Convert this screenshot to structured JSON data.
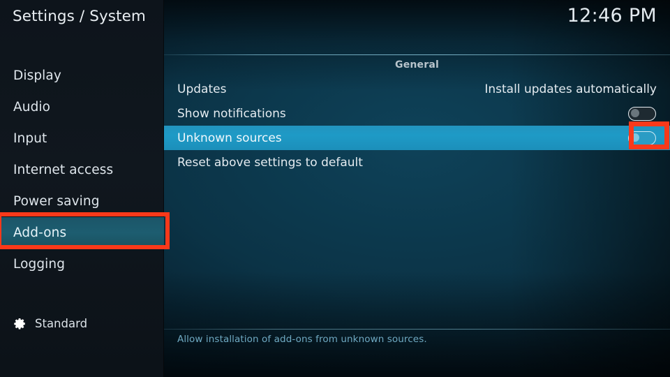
{
  "header": {
    "title": "Settings / System",
    "clock": "12:46 PM"
  },
  "sidebar": {
    "items": [
      {
        "label": "Display",
        "selected": false
      },
      {
        "label": "Audio",
        "selected": false
      },
      {
        "label": "Input",
        "selected": false
      },
      {
        "label": "Internet access",
        "selected": false
      },
      {
        "label": "Power saving",
        "selected": false
      },
      {
        "label": "Add-ons",
        "selected": true
      },
      {
        "label": "Logging",
        "selected": false
      }
    ],
    "profile": {
      "icon": "gear-icon",
      "label": "Standard"
    }
  },
  "main": {
    "group_header": "General",
    "rows": [
      {
        "label": "Updates",
        "type": "value",
        "value": "Install updates automatically",
        "selected": false
      },
      {
        "label": "Show notifications",
        "type": "toggle",
        "toggle_state": "off",
        "selected": false
      },
      {
        "label": "Unknown sources",
        "type": "toggle",
        "toggle_state": "off",
        "selected": true
      },
      {
        "label": "Reset above settings to default",
        "type": "action",
        "value": "",
        "selected": false
      }
    ],
    "help_text": "Allow installation of add-ons from unknown sources."
  },
  "annotations": {
    "color": "#f9391a",
    "boxes": [
      {
        "name": "addons-highlight",
        "target": "sidebar-item-add-ons"
      },
      {
        "name": "unknown-sources-toggle-highlight",
        "target": "unknown-sources-toggle"
      }
    ]
  },
  "colors": {
    "accent_row": "#1e9ac6",
    "sidebar_selected": "#1d5d70",
    "annotation_red": "#f9391a",
    "help_text": "#6fa9c2"
  }
}
